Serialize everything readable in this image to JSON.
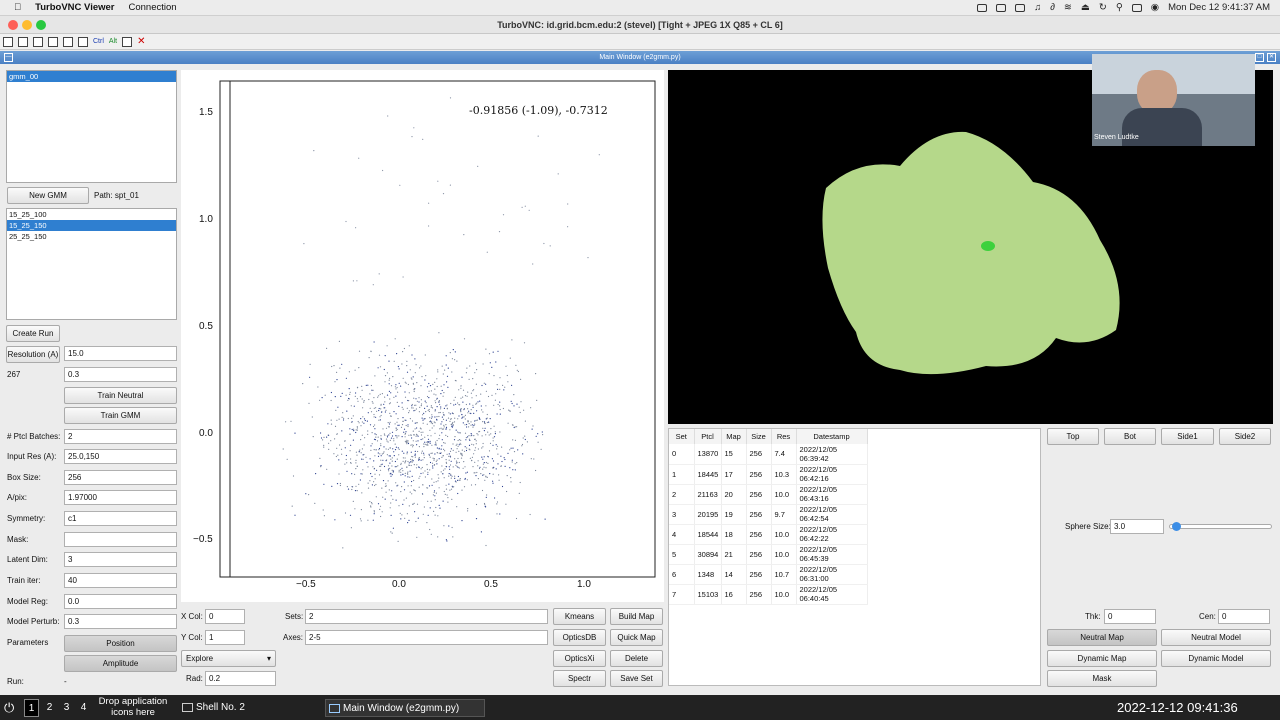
{
  "menubar": {
    "app": "TurboVNC Viewer",
    "menu": "Connection",
    "clock": "Mon Dec 12  9:41:37 AM"
  },
  "window_title": "TurboVNC: id.grid.bcm.edu:2 (stevel) [Tight + JPEG 1X Q85 + CL 6]",
  "toolbar": {
    "ctrl": "Ctrl",
    "alt": "Alt"
  },
  "inner_title": "Main Window (e2gmm.py)",
  "gmm_list": [
    "gmm_00"
  ],
  "new_gmm": "New GMM",
  "path_label": "Path: spt_01",
  "runs": [
    "15_25_100",
    "15_25_150",
    "25_25_150"
  ],
  "create_run": "Create Run",
  "resolution_btn": "Resolution (A)",
  "resolution_val": "15.0",
  "count_label": "267",
  "count_val": "0.3",
  "train_neutral": "Train Neutral",
  "train_gmm": "Train GMM",
  "params": [
    {
      "label": "# Ptcl Batches:",
      "value": "2"
    },
    {
      "label": "Input Res (A):",
      "value": "25.0,150"
    },
    {
      "label": "Box Size:",
      "value": "256"
    },
    {
      "label": "A/pix:",
      "value": "1.97000"
    },
    {
      "label": "Symmetry:",
      "value": "c1"
    },
    {
      "label": "Mask:",
      "value": ""
    },
    {
      "label": "Latent Dim:",
      "value": "3"
    },
    {
      "label": "Train iter:",
      "value": "40"
    },
    {
      "label": "Model Reg:",
      "value": "0.0"
    },
    {
      "label": "Model Perturb:",
      "value": "0.3"
    }
  ],
  "parameters_label": "Parameters",
  "position_btn": "Position",
  "amplitude_btn": "Amplitude",
  "run_label": "Run:",
  "run_val": "-",
  "plot": {
    "readout": "-0.91856 (-1.09), -0.7312",
    "yticks": [
      "1.5",
      "1.0",
      "0.5",
      "0.0",
      "−0.5"
    ],
    "xticks": [
      "−0.5",
      "0.0",
      "0.5",
      "1.0"
    ]
  },
  "controls": {
    "xcol_label": "X Col:",
    "xcol": "0",
    "ycol_label": "Y Col:",
    "ycol": "1",
    "mode": "Explore",
    "rad_label": "Rad:",
    "rad": "0.2",
    "sets_label": "Sets:",
    "sets": "2",
    "axes_label": "Axes:",
    "axes": "2-5",
    "kmeans": "Kmeans",
    "build_map": "Build Map",
    "opticsdb": "OpticsDB",
    "quick_map": "Quick Map",
    "opticsxi": "OpticsXi",
    "delete": "Delete",
    "spectr": "Spectr",
    "save_set": "Save Set"
  },
  "table": {
    "headers": [
      "Set",
      "Ptcl",
      "Map",
      "Size",
      "Res",
      "Datestamp"
    ],
    "rows": [
      [
        "0",
        "13870",
        "15",
        "256",
        "7.4",
        "2022/12/05 06:39:42"
      ],
      [
        "1",
        "18445",
        "17",
        "256",
        "10.3",
        "2022/12/05 06:42:16"
      ],
      [
        "2",
        "21163",
        "20",
        "256",
        "10.0",
        "2022/12/05 06:43:16"
      ],
      [
        "3",
        "20195",
        "19",
        "256",
        "9.7",
        "2022/12/05 06:42:54"
      ],
      [
        "4",
        "18544",
        "18",
        "256",
        "10.0",
        "2022/12/05 06:42:22"
      ],
      [
        "5",
        "30894",
        "21",
        "256",
        "10.0",
        "2022/12/05 06:45:39"
      ],
      [
        "6",
        "1348",
        "14",
        "256",
        "10.7",
        "2022/12/05 06:31:00"
      ],
      [
        "7",
        "15103",
        "16",
        "256",
        "10.0",
        "2022/12/05 06:40:45"
      ]
    ]
  },
  "view_buttons": {
    "top": "Top",
    "bot": "Bot",
    "side1": "Side1",
    "side2": "Side2"
  },
  "sphere_label": "Sphere Size:",
  "sphere_val": "3.0",
  "thk_label": "Thk:",
  "thk": "0",
  "cen_label": "Cen:",
  "cen": "0",
  "neutral_map": "Neutral Map",
  "neutral_model": "Neutral Model",
  "dynamic_map": "Dynamic Map",
  "dynamic_model": "Dynamic Model",
  "mask_btn": "Mask",
  "webcam_name": "Steven Ludtke",
  "taskbar": {
    "ws": [
      "1",
      "2",
      "3",
      "4"
    ],
    "drop": "Drop application icons here",
    "shell": "Shell No. 2",
    "main": "Main Window (e2gmm.py)",
    "clock": "2022-12-12  09:41:36"
  },
  "colors": {
    "selection": "#2f7fd0",
    "density": "#b5d88a",
    "titlebar": "#4a80c4"
  }
}
